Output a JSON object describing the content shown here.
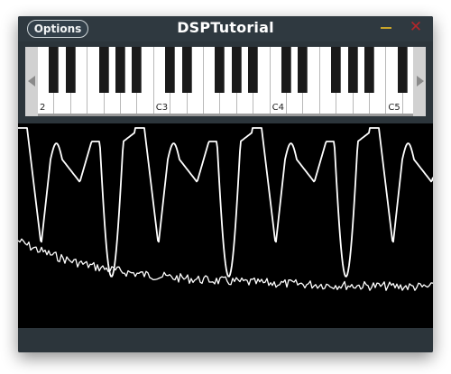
{
  "window": {
    "title": "DSPTutorial",
    "options_label": "Options",
    "close_glyph": "✕",
    "colors": {
      "background": "#2c353b",
      "minimize": "#c9a52a",
      "close": "#b3262a"
    }
  },
  "keyboard": {
    "labels": [
      {
        "note": "C2",
        "text": "2",
        "white_index": 0
      },
      {
        "note": "C3",
        "text": "C3",
        "white_index": 7
      },
      {
        "note": "C4",
        "text": "C4",
        "white_index": 14
      },
      {
        "note": "C5",
        "text": "C5",
        "white_index": 21
      }
    ],
    "scroll_left_icon": "triangle-left",
    "scroll_right_icon": "triangle-right"
  },
  "oscilloscope": {
    "background": "#000000",
    "waveform_color": "#ffffff",
    "spectrum_color": "#ffffff"
  }
}
